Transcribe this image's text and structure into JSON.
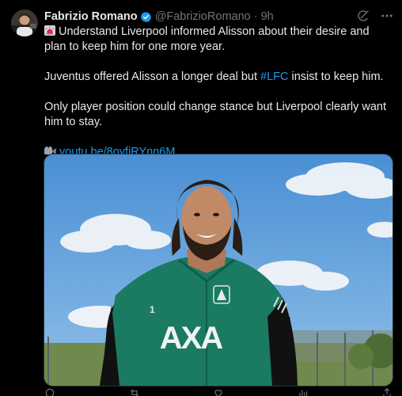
{
  "author": {
    "name": "Fabrizio Romano",
    "handle": "@FabrizioRomano",
    "separator": "·",
    "time": "9h",
    "verified_icon": "verified-badge-icon",
    "avatar": "avatar"
  },
  "header_actions": {
    "grok_icon": "grok-icon",
    "more_icon": "more-icon"
  },
  "tweet": {
    "line1": "Understand Liverpool informed Alisson about their desire and plan to keep him for one more year.",
    "line2_before": "Juventus offered Alisson a longer deal but ",
    "line2_hashtag": "#LFC",
    "line2_after": " insist to keep him.",
    "line3": "Only player position could change stance but Liverpool clearly want him to stay.",
    "link": "youtu.be/8oyfjRYnn6M",
    "siren_icon": "siren-icon",
    "film_icon": "film-icon"
  },
  "media": {
    "description_icon": "photo"
  },
  "colors": {
    "background": "#000000",
    "text": "#e7e9ea",
    "muted": "#71767b",
    "link": "#1d9bf0",
    "verified": "#1d9bf0"
  }
}
